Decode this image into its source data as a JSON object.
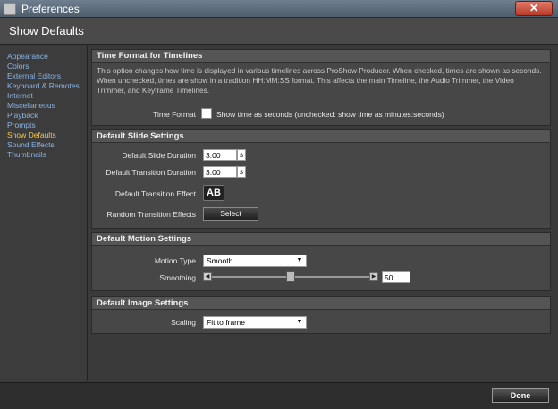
{
  "window": {
    "title": "Preferences",
    "close_glyph": "✕"
  },
  "header": {
    "title": "Show Defaults"
  },
  "sidebar": {
    "items": [
      {
        "label": "Appearance"
      },
      {
        "label": "Colors"
      },
      {
        "label": "External Editors"
      },
      {
        "label": "Keyboard & Remotes"
      },
      {
        "label": "Internet"
      },
      {
        "label": "Miscellaneous"
      },
      {
        "label": "Playback"
      },
      {
        "label": "Prompts"
      },
      {
        "label": "Show Defaults",
        "active": true
      },
      {
        "label": "Sound Effects"
      },
      {
        "label": "Thumbnails"
      }
    ]
  },
  "time_format": {
    "title": "Time Format for Timelines",
    "description": "This option changes how time is displayed in various timelines across ProShow Producer. When checked, times are shown as seconds. When unchecked, times are show in a tradition HH:MM:SS format. This affects the main Timeline, the Audio Trimmer, the Video Trimmer, and Keyframe Timelines.",
    "label": "Time Format",
    "checkbox_label": "Show time as seconds (unchecked: show time as minutes:seconds)",
    "checked": false
  },
  "slide_settings": {
    "title": "Default Slide Settings",
    "slide_duration_label": "Default Slide Duration",
    "slide_duration_value": "3.00",
    "slide_duration_unit": "s",
    "transition_duration_label": "Default Transition Duration",
    "transition_duration_value": "3.00",
    "transition_duration_unit": "s",
    "transition_effect_label": "Default Transition Effect",
    "transition_effect_glyph": "AB",
    "random_label": "Random Transition Effects",
    "select_button": "Select"
  },
  "motion_settings": {
    "title": "Default Motion Settings",
    "motion_type_label": "Motion Type",
    "motion_type_value": "Smooth",
    "smoothing_label": "Smoothing",
    "smoothing_value": "50",
    "smoothing_fraction": 0.5
  },
  "image_settings": {
    "title": "Default Image Settings",
    "scaling_label": "Scaling",
    "scaling_value": "Fit to frame"
  },
  "footer": {
    "done_button": "Done"
  },
  "icons": {
    "dropdown": "chevron-down-icon",
    "slider_left": "triangle-left-icon",
    "slider_right": "triangle-right-icon"
  }
}
